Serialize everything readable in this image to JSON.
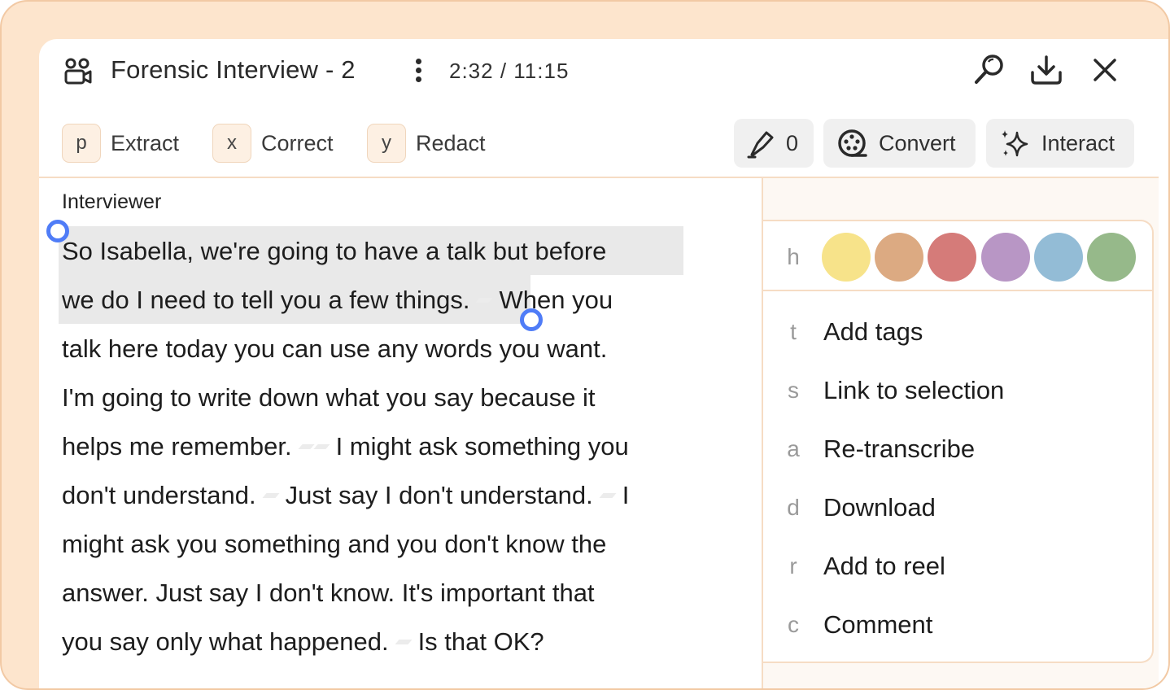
{
  "header": {
    "title": "Forensic Interview - 2",
    "time": "2:32 / 11:15"
  },
  "toolbar": {
    "actions": [
      {
        "key": "p",
        "label": "Extract"
      },
      {
        "key": "x",
        "label": "Correct"
      },
      {
        "key": "y",
        "label": "Redact"
      }
    ],
    "highlight_count": "0",
    "convert_label": "Convert",
    "interact_label": "Interact"
  },
  "transcript": {
    "speaker": "Interviewer",
    "lines": [
      [
        "So Isabella, we're going to have a talk but before"
      ],
      [
        "we do I need to tell you a few things.",
        "When you"
      ],
      [
        "talk here today you can use any words you want."
      ],
      [
        "I'm going to write down what you say because it"
      ],
      [
        "helps me remember.",
        "I might ask something you"
      ],
      [
        "don't understand.",
        "Just say I don't understand.",
        "I"
      ],
      [
        "might ask you something and you don't know the"
      ],
      [
        "answer. Just say I don't know. It's important that"
      ],
      [
        "you say only what happened.",
        "Is that OK?"
      ]
    ]
  },
  "menu": {
    "color_key": "h",
    "colors": [
      "#f7e38a",
      "#dcaa82",
      "#d57b79",
      "#b896c5",
      "#93bcd6",
      "#96b98a"
    ],
    "items": [
      {
        "key": "t",
        "label": "Add tags"
      },
      {
        "key": "s",
        "label": "Link to selection"
      },
      {
        "key": "a",
        "label": "Re-transcribe"
      },
      {
        "key": "d",
        "label": "Download"
      },
      {
        "key": "r",
        "label": "Add to reel"
      },
      {
        "key": "c",
        "label": "Comment"
      }
    ]
  }
}
